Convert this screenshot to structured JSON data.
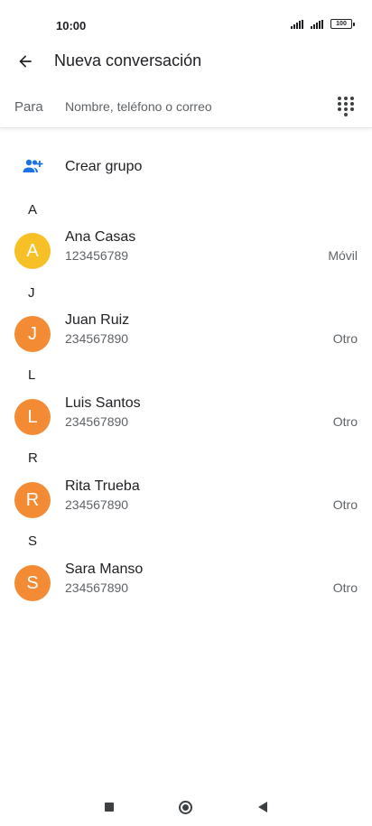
{
  "status_bar": {
    "time": "10:00",
    "battery": "100",
    "signal_icons": [
      "signal-icon",
      "signal-icon"
    ]
  },
  "app_bar": {
    "back_icon": "arrow-back-icon",
    "title": "Nueva conversación"
  },
  "recipient": {
    "label": "Para",
    "placeholder": "Nombre, teléfono o correo",
    "value": "",
    "dialpad_icon": "dialpad-icon"
  },
  "create_group": {
    "icon": "group-add-icon",
    "label": "Crear grupo"
  },
  "sections": [
    {
      "letter": "A",
      "contacts": [
        {
          "initial": "A",
          "name": "Ana Casas",
          "number": "123456789",
          "type": "Móvil",
          "color": "#f6c026"
        }
      ]
    },
    {
      "letter": "J",
      "contacts": [
        {
          "initial": "J",
          "name": "Juan Ruiz",
          "number": "234567890",
          "type": "Otro",
          "color": "#f28b33"
        }
      ]
    },
    {
      "letter": "L",
      "contacts": [
        {
          "initial": "L",
          "name": "Luis Santos",
          "number": "234567890",
          "type": "Otro",
          "color": "#f28b33"
        }
      ]
    },
    {
      "letter": "R",
      "contacts": [
        {
          "initial": "R",
          "name": "Rita Trueba",
          "number": "234567890",
          "type": "Otro",
          "color": "#f28b33"
        }
      ]
    },
    {
      "letter": "S",
      "contacts": [
        {
          "initial": "S",
          "name": "Sara Manso",
          "number": "234567890",
          "type": "Otro",
          "color": "#f28b33"
        }
      ]
    }
  ],
  "nav_bar": {
    "recents_icon": "square-recents-icon",
    "home_icon": "circle-home-icon",
    "back_icon": "triangle-back-icon"
  },
  "colors": {
    "accent": "#1a73e8",
    "avatar_yellow": "#f6c026",
    "avatar_orange": "#f28b33"
  }
}
